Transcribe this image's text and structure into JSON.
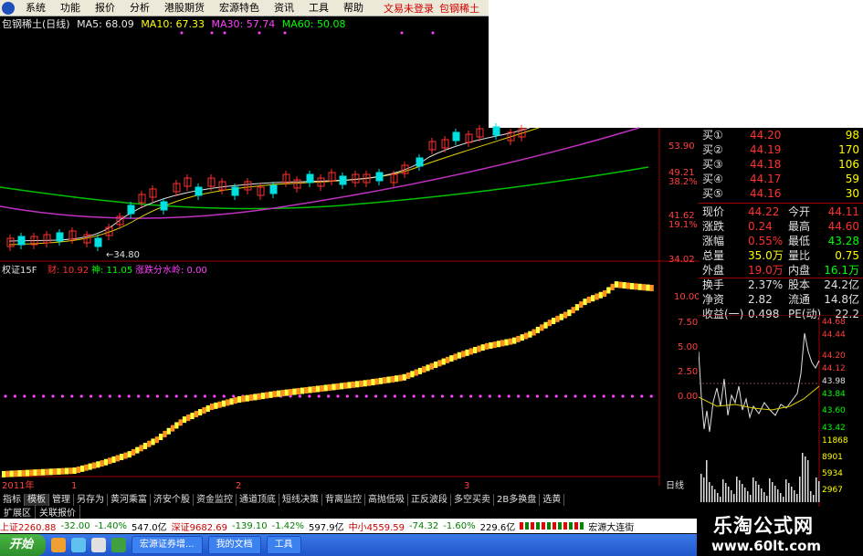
{
  "menubar": {
    "items": [
      "系统",
      "功能",
      "报价",
      "分析",
      "港股期货",
      "宏源特色",
      "资讯",
      "工具",
      "帮助"
    ],
    "notice_left": "文易未登录",
    "notice_right": "包钢稀土"
  },
  "chart_header": {
    "stock": "包钢稀土(日线)",
    "ma5": "MA5: 68.09",
    "ma10": "MA10: 67.33",
    "ma30": "MA30: 57.74",
    "ma60": "MA60: 50.08"
  },
  "price_axis": [
    "53.90",
    "49.21",
    "38.2%",
    "41.62",
    "19.1%",
    "34.02"
  ],
  "low_label": "←34.80",
  "indicator_header": {
    "name": "权证15F",
    "t1": "财: 10.92",
    "t2": "神: 11.05",
    "t3": "涨跌分水岭: 0.00"
  },
  "indicator_axis": [
    "10.00",
    "7.50",
    "5.00",
    "2.50",
    "0.00"
  ],
  "x_labels": [
    "2011年",
    "1",
    "2",
    "3"
  ],
  "period_label": "日线",
  "quotes": {
    "buy": [
      {
        "label": "买①",
        "price": "44.20",
        "vol": "98"
      },
      {
        "label": "买②",
        "price": "44.19",
        "vol": "170"
      },
      {
        "label": "买③",
        "price": "44.18",
        "vol": "106"
      },
      {
        "label": "买④",
        "price": "44.17",
        "vol": "59"
      },
      {
        "label": "买⑤",
        "price": "44.16",
        "vol": "30"
      }
    ],
    "info": [
      {
        "a": "现价",
        "av": "44.22",
        "b": "今开",
        "bv": "44.11"
      },
      {
        "a": "涨跌",
        "av": "0.24",
        "b": "最高",
        "bv": "44.60"
      },
      {
        "a": "涨幅",
        "av": "0.55%",
        "b": "最低",
        "bv": "43.28"
      },
      {
        "a": "总量",
        "av": "35.0万",
        "b": "量比",
        "bv": "0.75"
      },
      {
        "a": "外盘",
        "av": "19.0万",
        "b": "内盘",
        "bv": "16.1万"
      },
      {
        "a": "换手",
        "av": "2.37%",
        "b": "股本",
        "bv": "24.2亿"
      },
      {
        "a": "净资",
        "av": "2.82",
        "b": "流通",
        "bv": "14.8亿"
      },
      {
        "a": "收益(一)",
        "av": "0.498",
        "b": "PE(动)",
        "bv": "22.2"
      }
    ]
  },
  "intraday_axis": [
    "44.68",
    "44.44",
    "44.20",
    "44.12",
    "43.98",
    "43.84",
    "43.60",
    "43.42",
    "11868",
    "8901",
    "5934",
    "2967"
  ],
  "tabs_row1": [
    "指标",
    "模板",
    "管理",
    "另存为",
    "黄河乘富",
    "济安个股",
    "资金监控",
    "通道顶底",
    "短线决策",
    "背离监控",
    "高抛低吸",
    "正反波段",
    "多空买卖",
    "2B多换盘",
    "选黄"
  ],
  "tabs_row2": [
    "扩展区",
    "关联报价"
  ],
  "statusbar": {
    "sh": "上证2260.88",
    "sh_chg": "-32.00",
    "sh_pct": "-1.40%",
    "sh_amt": "547.0亿",
    "sz": "深证9682.69",
    "sz_chg": "-139.10",
    "sz_pct": "-1.42%",
    "sz_amt": "597.9亿",
    "zx": "中小4559.59",
    "zx_chg": "-74.32",
    "zx_pct": "-1.60%",
    "zx_amt": "229.6亿",
    "broker": "宏源大连街"
  },
  "taskbar": {
    "start": "开始",
    "apps": [
      "宏源证券增...",
      "我的文档",
      "工具"
    ]
  },
  "watermark": {
    "line1": "乐淘公式网",
    "line2": "www.60lt.com"
  },
  "colors": {
    "up": "#ff3030",
    "down": "#00e0e0",
    "ma5": "#ffffff",
    "ma10": "#ffff00",
    "ma30": "#ff40ff",
    "ma60": "#00ff00",
    "indicator": "#ffff00"
  }
}
